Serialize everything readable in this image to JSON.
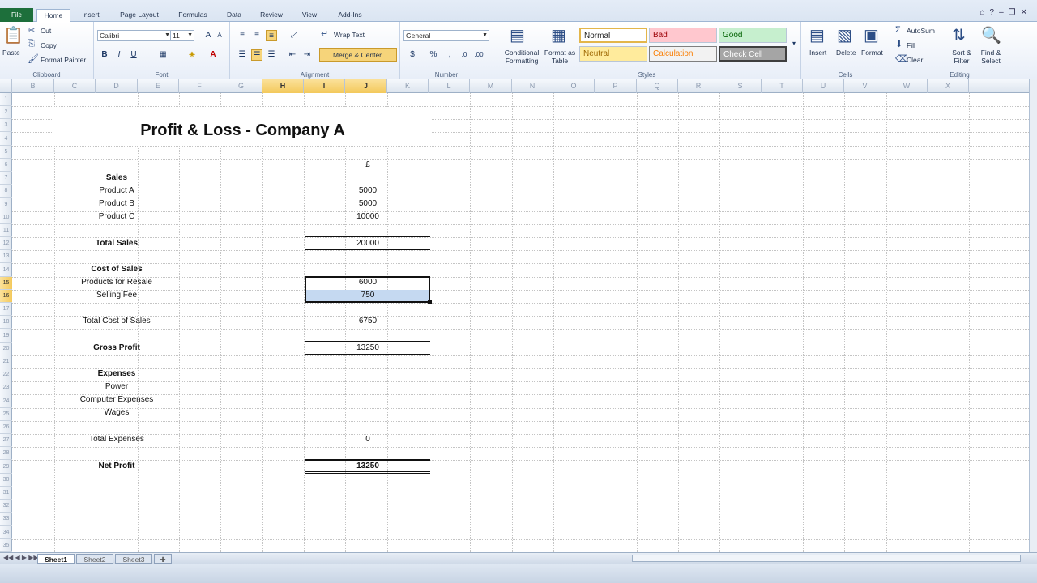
{
  "file_tab": "File",
  "ribbon_tabs": [
    "Home",
    "Insert",
    "Page Layout",
    "Formulas",
    "Data",
    "Review",
    "View",
    "Add-Ins"
  ],
  "active_tab": "Home",
  "clipboard": {
    "paste": "Paste",
    "cut": "Cut",
    "copy": "Copy",
    "format_painter": "Format Painter",
    "label": "Clipboard"
  },
  "font": {
    "name": "Calibri",
    "size": "11",
    "bold": "B",
    "italic": "I",
    "underline": "U",
    "label": "Font"
  },
  "alignment": {
    "wrap_text": "Wrap Text",
    "merge_center": "Merge & Center",
    "label": "Alignment"
  },
  "number": {
    "format": "General",
    "percent": "%",
    "comma": ",",
    "label": "Number"
  },
  "styles_group": {
    "conditional_formatting": "Conditional Formatting",
    "format_as_table": "Format as Table",
    "normal": "Normal",
    "bad": "Bad",
    "good": "Good",
    "neutral": "Neutral",
    "calculation": "Calculation",
    "check_cell": "Check Cell",
    "label": "Styles",
    "colors": {
      "normal_bg": "#ffffff",
      "bad_bg": "#ffc7ce",
      "bad_fg": "#9c0006",
      "good_bg": "#c6efce",
      "neutral_bg": "#ffeb9c",
      "calc_bg": "#f2f2f2",
      "check_bg": "#a5a5a5"
    }
  },
  "cells_group": {
    "insert": "Insert",
    "delete": "Delete",
    "format": "Format",
    "label": "Cells"
  },
  "editing": {
    "autosum": "AutoSum",
    "fill": "Fill",
    "clear": "Clear",
    "sort_filter": "Sort & Filter",
    "find_select": "Find & Select",
    "label": "Editing"
  },
  "columns": [
    "B",
    "C",
    "D",
    "E",
    "F",
    "G",
    "H",
    "I",
    "J",
    "K",
    "L",
    "M",
    "N",
    "O",
    "P",
    "Q",
    "R",
    "S",
    "T",
    "U",
    "V",
    "W",
    "X"
  ],
  "selected_columns": [
    "H",
    "I",
    "J"
  ],
  "rows": [
    "1",
    "2",
    "3",
    "4",
    "5",
    "6",
    "7",
    "8",
    "9",
    "10",
    "11",
    "12",
    "13",
    "14",
    "15",
    "16",
    "17",
    "18",
    "19",
    "20",
    "21",
    "22",
    "23",
    "24",
    "25",
    "26",
    "27",
    "28",
    "29",
    "30",
    "31",
    "32",
    "33",
    "34",
    "35"
  ],
  "selected_rows": [
    "15",
    "16"
  ],
  "sheet": {
    "title": "Profit & Loss - Company A",
    "currency_header": "£",
    "sales_header": "Sales",
    "product_a": "Product A",
    "product_a_val": "5000",
    "product_b": "Product B",
    "product_b_val": "5000",
    "product_c": "Product C",
    "product_c_val": "10000",
    "total_sales": "Total Sales",
    "total_sales_val": "20000",
    "cost_header": "Cost of Sales",
    "products_resale": "Products for Resale",
    "products_resale_val": "6000",
    "selling_fee": "Selling Fee",
    "selling_fee_val": "750",
    "total_cost": "Total Cost of Sales",
    "total_cost_val": "6750",
    "gross_profit": "Gross Profit",
    "gross_profit_val": "13250",
    "expenses_header": "Expenses",
    "power": "Power",
    "computer_expenses": "Computer Expenses",
    "wages": "Wages",
    "total_expenses": "Total Expenses",
    "total_expenses_val": "0",
    "net_profit": "Net Profit",
    "net_profit_val": "13250"
  },
  "sheet_tabs": [
    "Sheet1",
    "Sheet2",
    "Sheet3"
  ],
  "active_sheet": "Sheet1",
  "selection_color": "#c5d9f1"
}
